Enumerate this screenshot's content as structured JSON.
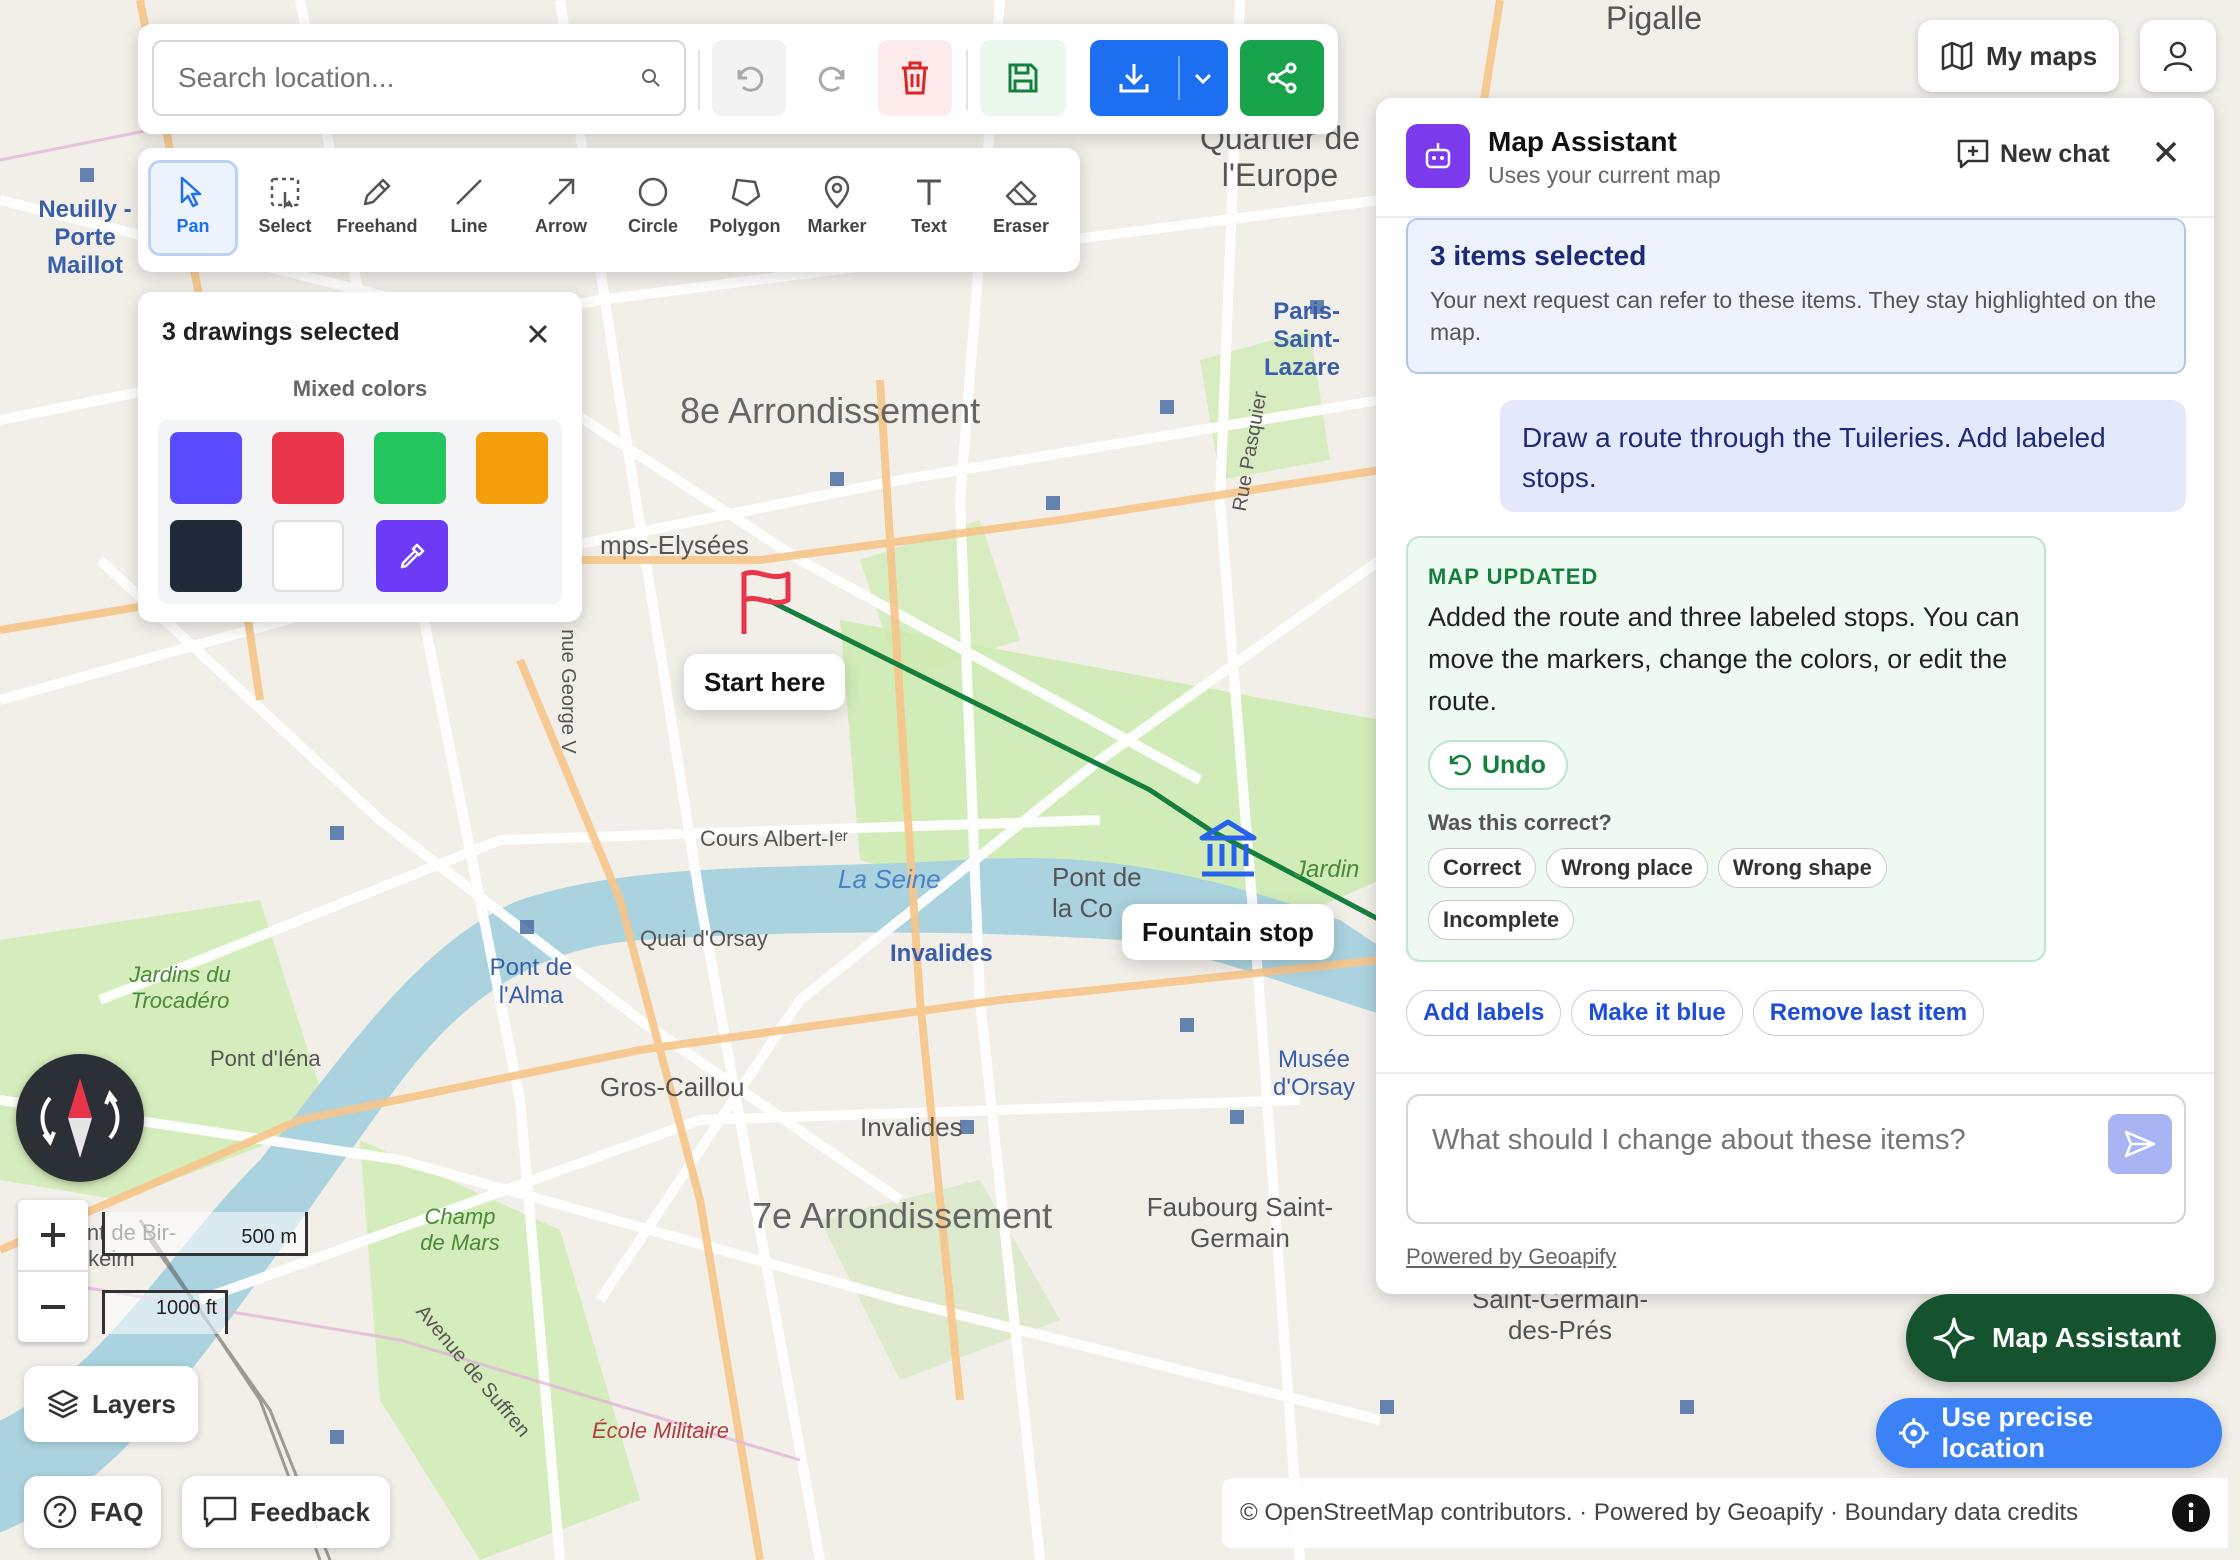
{
  "search": {
    "placeholder": "Search location..."
  },
  "toolbar": {
    "tools": [
      {
        "label": "Pan",
        "icon": "cursor-icon"
      },
      {
        "label": "Select",
        "icon": "select-box-icon"
      },
      {
        "label": "Freehand",
        "icon": "pencil-icon"
      },
      {
        "label": "Line",
        "icon": "line-icon"
      },
      {
        "label": "Arrow",
        "icon": "arrow-icon"
      },
      {
        "label": "Circle",
        "icon": "circle-icon"
      },
      {
        "label": "Polygon",
        "icon": "polygon-icon"
      },
      {
        "label": "Marker",
        "icon": "marker-icon"
      },
      {
        "label": "Text",
        "icon": "text-icon"
      },
      {
        "label": "Eraser",
        "icon": "eraser-icon"
      }
    ],
    "active_tool": "Pan"
  },
  "header": {
    "my_maps": "My maps"
  },
  "selection_panel": {
    "title": "3 drawings selected",
    "subtitle": "Mixed colors",
    "colors": [
      "#5b4bff",
      "#e8354a",
      "#22c55e",
      "#f59e0b",
      "#1f2937",
      "#ffffff"
    ],
    "picker_color": "#6d3bf5"
  },
  "map": {
    "labels": {
      "arrondissement_8": "8e Arrondissement",
      "arrondissement_7": "7e Arrondissement",
      "champs": "mps-Elysées",
      "cours": "Cours Albert-Iᵉʳ",
      "seine": "La Seine",
      "quai": "Quai d'Orsay",
      "invalides1": "Invalides",
      "invalides2": "Invalides",
      "gros_caillou": "Gros-Caillou",
      "pont_alma": "Pont de l'Alma",
      "pont_iena": "Pont d'Iéna",
      "jardins": "Jardins du Trocadéro",
      "champ_mars": "Champ de Mars",
      "ecole": "École Militaire",
      "avenue_suffren": "Avenue de Suffren",
      "faubourg": "Faubourg Saint-Germain",
      "st_germain": "Saint-Germain-des-Prés",
      "musee": "Musée d'Orsay",
      "europe": "Quartier de l'Europe",
      "pigalle": "Pigalle",
      "paris_lazare": "Paris-Saint-Lazare",
      "neuilly": "Neuilly - Porte Maillot",
      "pont_conc": "Pont de la Co",
      "pont_bir": "Pont de Bir-Hakeim",
      "george_v": "nue George V",
      "rue_pasquier": "Rue Pasquier",
      "jardin": "Jardin"
    },
    "markers": {
      "start": "Start here",
      "fountain": "Fountain stop"
    },
    "route_color": "#15803d",
    "scale": {
      "metric": "500 m",
      "imperial": "1000 ft"
    }
  },
  "assistant": {
    "title": "Map Assistant",
    "subtitle": "Uses your current map",
    "new_chat": "New chat",
    "selection_notice": {
      "title": "3 items selected",
      "body": "Your next request can refer to these items. They stay highlighted on the map."
    },
    "user_message": "Draw a route through the Tuileries. Add labeled stops.",
    "reply": {
      "tag": "MAP UPDATED",
      "body": "Added the route and three labeled stops. You can move the markers, change the colors, or edit the route.",
      "undo": "Undo",
      "question": "Was this correct?",
      "feedback": [
        "Correct",
        "Wrong place",
        "Wrong shape",
        "Incomplete"
      ]
    },
    "suggestions": [
      "Add labels",
      "Make it blue",
      "Remove last item"
    ],
    "input_placeholder": "What should I change about these items?",
    "powered": "Powered by Geoapify"
  },
  "buttons": {
    "map_assistant": "Map Assistant",
    "precise_location": "Use precise location",
    "layers": "Layers",
    "faq": "FAQ",
    "feedback": "Feedback"
  },
  "attribution": "© OpenStreetMap contributors. · Powered by Geoapify · Boundary data credits"
}
